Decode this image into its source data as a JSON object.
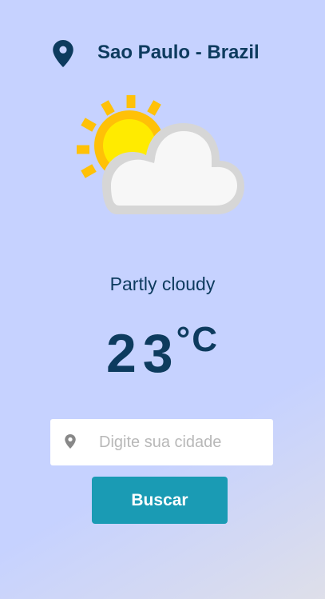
{
  "location": {
    "name": "Sao Paulo - Brazil",
    "icon": "map-pin-icon"
  },
  "weather": {
    "icon": "partly-cloudy-icon",
    "condition": "Partly cloudy",
    "temperature": "23",
    "unit": "°C"
  },
  "search": {
    "icon": "map-pin-icon",
    "placeholder": "Digite sua cidade",
    "value": "",
    "button_label": "Buscar"
  },
  "colors": {
    "background": "#c6d2ff",
    "text": "#0d3b5e",
    "button": "#1a9bb4",
    "sun": "#ffc107",
    "cloud": "#f7f7f7"
  }
}
